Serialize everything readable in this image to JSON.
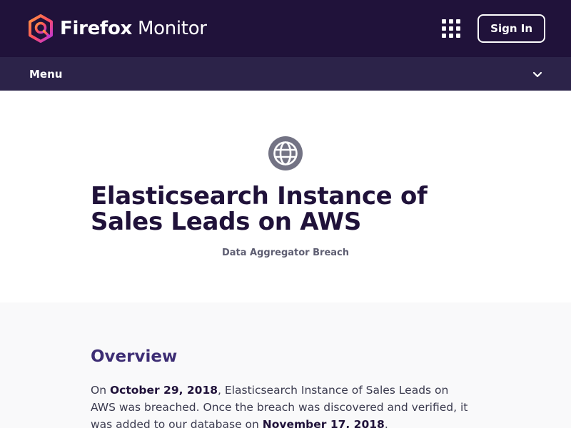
{
  "header": {
    "brand_bold": "Firefox",
    "brand_regular": "Monitor",
    "apps_icon": "grid-apps-icon",
    "signin_label": "Sign In"
  },
  "menu": {
    "label": "Menu",
    "icon": "chevron-down-icon"
  },
  "hero": {
    "icon": "globe-icon",
    "title": "Elasticsearch Instance of Sales Leads on AWS",
    "subtitle": "Data Aggregator Breach"
  },
  "overview": {
    "heading": "Overview",
    "p_on": "On",
    "breach_date": "October 29, 2018",
    "p_mid": ", Elasticsearch Instance of Sales Leads on AWS was breached. Once the breach was discovered and verified, it was added to our database on",
    "added_date": "November 17, 2018",
    "p_end": "."
  },
  "colors": {
    "header_bg": "#20123a",
    "menubar_bg": "#2c2349",
    "overview_bg": "#f9f9fa",
    "heading_purple": "#3d2d74"
  }
}
